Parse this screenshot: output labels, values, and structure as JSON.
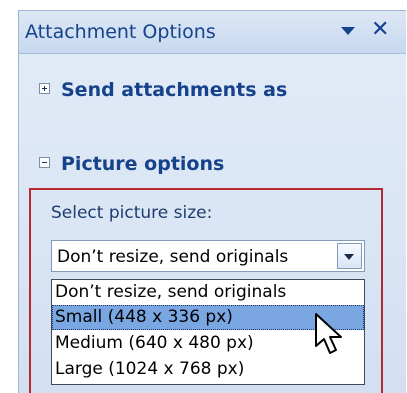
{
  "pane": {
    "title": "Attachment Options"
  },
  "sections": {
    "send_as": "Send attachments as",
    "picture": "Picture options"
  },
  "picture_options": {
    "label": "Select picture size:",
    "selected_value": "Don’t resize, send originals",
    "options": [
      "Don’t resize, send originals",
      "Small (448 x 336 px)",
      "Medium (640 x 480 px)",
      "Large (1024 x 768 px)"
    ],
    "highlighted_index": 1
  },
  "colors": {
    "pane_bg": "#dce7f5",
    "header_text": "#15428b",
    "highlight_box": "#b52a2e",
    "selection": "#7aa7e2"
  },
  "icons": {
    "title_menu": "chevron-down-icon",
    "title_close": "close-icon",
    "expand": "plus-icon",
    "collapse": "minus-icon",
    "cursor": "mouse-pointer-icon"
  }
}
